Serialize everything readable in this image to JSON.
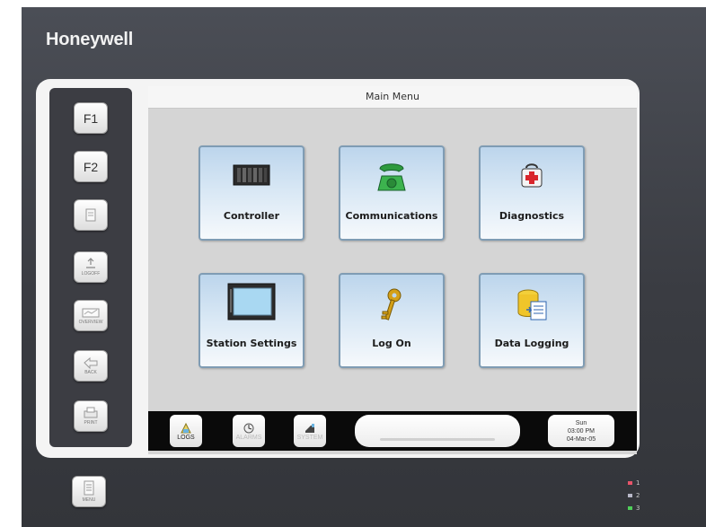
{
  "brand": "Honeywell",
  "screen_title": "Main Menu",
  "function_keys": [
    {
      "label": "F1",
      "icon": "f1-key"
    },
    {
      "label": "F2",
      "icon": "f2-key"
    },
    {
      "label": "",
      "icon": "page-icon"
    },
    {
      "label": "LOGOFF",
      "icon": "logoff-icon"
    },
    {
      "label": "OVERVIEW",
      "icon": "overview-icon"
    },
    {
      "label": "BACK",
      "icon": "back-icon"
    },
    {
      "label": "PRINT",
      "icon": "print-icon"
    }
  ],
  "menu_key": {
    "label": "MENU",
    "icon": "menu-icon"
  },
  "tiles": [
    {
      "label": "Controller",
      "icon": "controller-icon"
    },
    {
      "label": "Communications",
      "icon": "telephone-icon"
    },
    {
      "label": "Diagnostics",
      "icon": "first-aid-kit-icon"
    },
    {
      "label": "Station Settings",
      "icon": "display-panel-icon"
    },
    {
      "label": "Log On",
      "icon": "key-icon"
    },
    {
      "label": "Data Logging",
      "icon": "data-log-icon"
    }
  ],
  "taskbar": {
    "logs_label": "LOGS",
    "alarm_label": "ALARMS",
    "system_label": "SYSTEM"
  },
  "clock": {
    "day": "Sun",
    "time": "03:00 PM",
    "date": "04-Mar-05"
  },
  "leds": [
    {
      "label": "1",
      "color": "#e8546a"
    },
    {
      "label": "2",
      "color": "#b8b8c8"
    },
    {
      "label": "3",
      "color": "#4fcf5a"
    }
  ]
}
